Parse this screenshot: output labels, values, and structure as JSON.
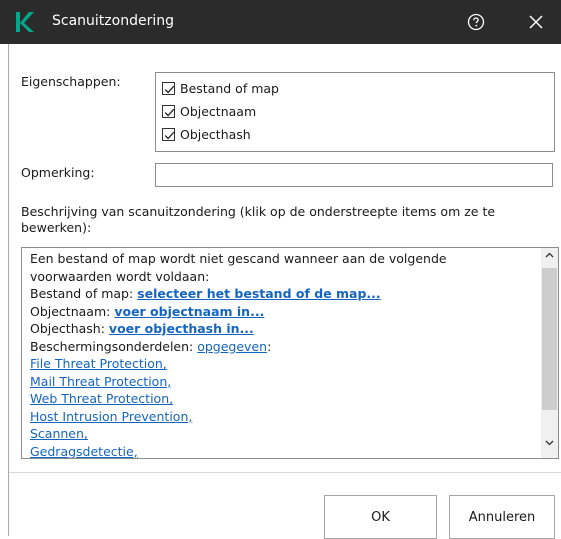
{
  "window": {
    "title": "Scanuitzondering"
  },
  "properties": {
    "label": "Eigenschappen:",
    "items": [
      {
        "label": "Bestand of map",
        "checked": true
      },
      {
        "label": "Objectnaam",
        "checked": true
      },
      {
        "label": "Objecthash",
        "checked": true
      }
    ]
  },
  "remark": {
    "label": "Opmerking:",
    "value": ""
  },
  "description": {
    "label": "Beschrijving van scanuitzondering (klik op de onderstreepte items om ze te bewerken):",
    "intro_line1": "Een bestand of map wordt niet gescand wanneer aan de volgende",
    "intro_line2": "voorwaarden wordt voldaan:",
    "file_label": "Bestand of map: ",
    "file_link": "selecteer het bestand of de map...",
    "objname_label": "Objectnaam: ",
    "objname_link": "voer objectnaam in...",
    "objhash_label": "Objecthash: ",
    "objhash_link": "voer objecthash in...",
    "components_label": "Beschermingsonderdelen: ",
    "components_link": "opgegeven",
    "components_suffix": ":",
    "components": [
      "File Threat Protection,",
      "Mail Threat Protection,",
      "Web Threat Protection,",
      "Host Intrusion Prevention,",
      "Scannen,",
      "Gedragsdetectie,"
    ]
  },
  "buttons": {
    "ok": "OK",
    "cancel": "Annuleren"
  },
  "colors": {
    "titlebar": "#2b2b2b",
    "brand_green": "#00a88e",
    "link": "#1565c0"
  }
}
